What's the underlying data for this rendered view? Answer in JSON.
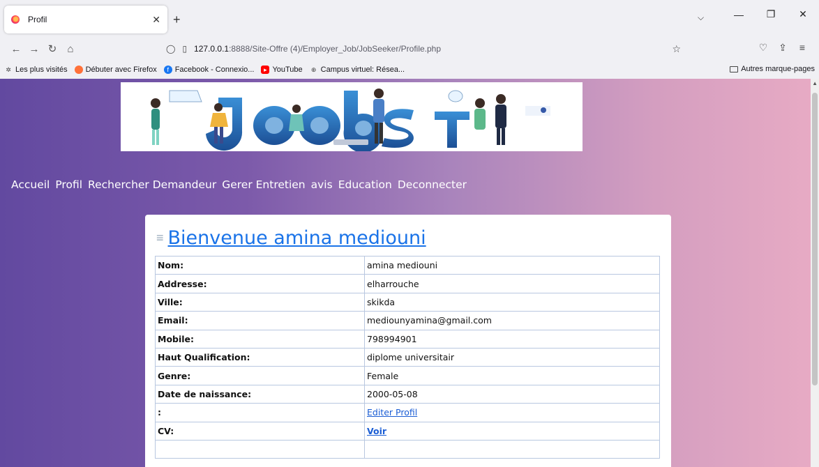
{
  "browser": {
    "tab_title": "Profil",
    "url_host": "127.0.0.1",
    "url_rest": ":8888/Site-Offre (4)/Employer_Job/JobSeeker/Profile.php",
    "bookmarks": [
      {
        "label": "Les plus visités",
        "icon": "gear-icon",
        "color": "#444444"
      },
      {
        "label": "Débuter avec Firefox",
        "icon": "firefox-icon",
        "color": "#ff7139"
      },
      {
        "label": "Facebook - Connexio...",
        "icon": "facebook-icon",
        "color": "#1877f2"
      },
      {
        "label": "YouTube",
        "icon": "youtube-icon",
        "color": "#ff0000"
      },
      {
        "label": "Campus virtuel: Résea...",
        "icon": "globe-icon",
        "color": "#444444"
      }
    ],
    "other_bookmarks": "Autres marque-pages"
  },
  "menu": {
    "items": [
      "Accueil",
      "Profil",
      "Rechercher Demandeur",
      "Gerer Entretien",
      "avis",
      "Education",
      "Deconnecter"
    ]
  },
  "profile": {
    "title": "Bienvenue amina mediouni",
    "rows": [
      {
        "label": "Nom:",
        "value": "amina mediouni"
      },
      {
        "label": "Addresse:",
        "value": "elharrouche"
      },
      {
        "label": "Ville:",
        "value": "skikda"
      },
      {
        "label": "Email:",
        "value": "mediounyamina@gmail.com"
      },
      {
        "label": "Mobile:",
        "value": "798994901"
      },
      {
        "label": "Haut Qualification:",
        "value": "diplome universitair"
      },
      {
        "label": "Genre:",
        "value": "Female"
      },
      {
        "label": "Date de naissance:",
        "value": "2000-05-08"
      }
    ],
    "edit_label": ":",
    "edit_link": "Editer Profil",
    "cv_label": "CV:",
    "cv_link": "Voir"
  },
  "colors": {
    "gradient_start": "#6249a0",
    "gradient_end": "#e8abc4",
    "link": "#1a73e8"
  }
}
